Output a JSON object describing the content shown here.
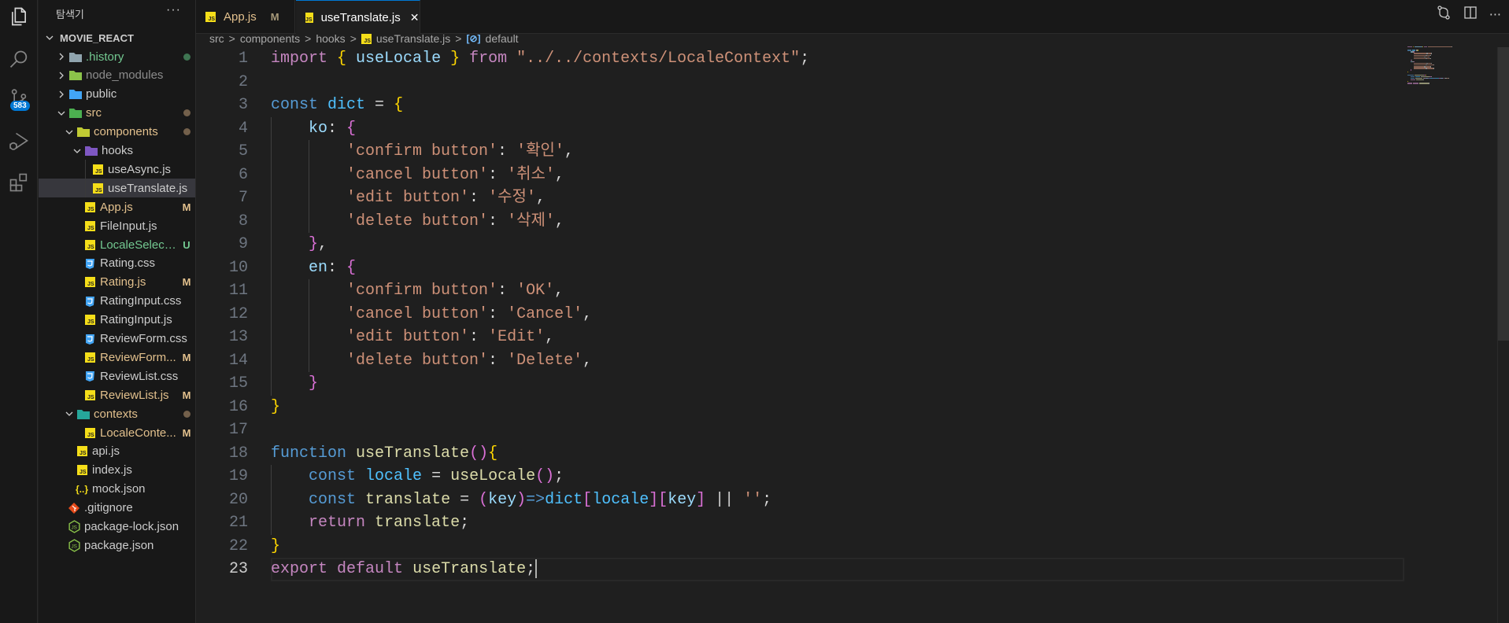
{
  "activity_bar": {
    "items": [
      {
        "name": "explorer",
        "icon": "files-icon"
      },
      {
        "name": "search",
        "icon": "search-icon"
      },
      {
        "name": "source-control",
        "icon": "source-control-icon",
        "badge": "583"
      },
      {
        "name": "run-debug",
        "icon": "run-debug-icon"
      },
      {
        "name": "extensions",
        "icon": "extensions-icon"
      }
    ]
  },
  "sidebar": {
    "title": "탐색기",
    "more": "···",
    "root": "MOVIE_REACT",
    "items": [
      {
        "label": ".history",
        "type": "folder",
        "level": 0,
        "expanded": false,
        "color": "#73c991",
        "icon_color": "#90a4ae",
        "status": "dot",
        "status_color": "#3f7552"
      },
      {
        "label": "node_modules",
        "type": "folder",
        "level": 0,
        "expanded": false,
        "color": "#8c8c8c",
        "icon_color": "#8bc34a",
        "status": ""
      },
      {
        "label": "public",
        "type": "folder",
        "level": 0,
        "expanded": false,
        "color": "#cccccc",
        "icon_color": "#42a5f5",
        "status": ""
      },
      {
        "label": "src",
        "type": "folder",
        "level": 0,
        "expanded": true,
        "color": "#e2c08d",
        "icon_color": "#4caf50",
        "status": "dot",
        "status_color": "#73604b"
      },
      {
        "label": "components",
        "type": "folder",
        "level": 1,
        "expanded": true,
        "color": "#e2c08d",
        "icon_color": "#c0ca33",
        "status": "dot",
        "status_color": "#73604b"
      },
      {
        "label": "hooks",
        "type": "folder",
        "level": 2,
        "expanded": true,
        "color": "#cccccc",
        "icon_color": "#7e57c2",
        "status": ""
      },
      {
        "label": "useAsync.js",
        "type": "js",
        "level": 3,
        "color": "#cccccc",
        "status": ""
      },
      {
        "label": "useTranslate.js",
        "type": "js",
        "level": 3,
        "color": "#cccccc",
        "status": "",
        "selected": true
      },
      {
        "label": "App.js",
        "type": "js",
        "level": 2,
        "color": "#e2c08d",
        "status": "M",
        "status_color": "#e2c08d"
      },
      {
        "label": "FileInput.js",
        "type": "js",
        "level": 2,
        "color": "#cccccc",
        "status": ""
      },
      {
        "label": "LocaleSelect.js",
        "type": "js",
        "level": 2,
        "color": "#73c991",
        "status": "U",
        "status_color": "#73c991"
      },
      {
        "label": "Rating.css",
        "type": "css",
        "level": 2,
        "color": "#cccccc",
        "status": ""
      },
      {
        "label": "Rating.js",
        "type": "js",
        "level": 2,
        "color": "#e2c08d",
        "status": "M",
        "status_color": "#e2c08d"
      },
      {
        "label": "RatingInput.css",
        "type": "css",
        "level": 2,
        "color": "#cccccc",
        "status": ""
      },
      {
        "label": "RatingInput.js",
        "type": "js",
        "level": 2,
        "color": "#cccccc",
        "status": ""
      },
      {
        "label": "ReviewForm.css",
        "type": "css",
        "level": 2,
        "color": "#cccccc",
        "status": ""
      },
      {
        "label": "ReviewForm...",
        "type": "js",
        "level": 2,
        "color": "#e2c08d",
        "status": "M",
        "status_color": "#e2c08d"
      },
      {
        "label": "ReviewList.css",
        "type": "css",
        "level": 2,
        "color": "#cccccc",
        "status": ""
      },
      {
        "label": "ReviewList.js",
        "type": "js",
        "level": 2,
        "color": "#e2c08d",
        "status": "M",
        "status_color": "#e2c08d"
      },
      {
        "label": "contexts",
        "type": "folder",
        "level": 1,
        "expanded": true,
        "color": "#e2c08d",
        "icon_color": "#26a69a",
        "status": "dot",
        "status_color": "#73604b"
      },
      {
        "label": "LocaleConte...",
        "type": "js",
        "level": 2,
        "color": "#e2c08d",
        "status": "M",
        "status_color": "#e2c08d"
      },
      {
        "label": "api.js",
        "type": "js",
        "level": 1,
        "color": "#cccccc",
        "status": ""
      },
      {
        "label": "index.js",
        "type": "js",
        "level": 1,
        "color": "#cccccc",
        "status": ""
      },
      {
        "label": "mock.json",
        "type": "json",
        "level": 1,
        "color": "#cccccc",
        "status": ""
      },
      {
        "label": ".gitignore",
        "type": "git",
        "level": 0,
        "color": "#cccccc",
        "status": ""
      },
      {
        "label": "package-lock.json",
        "type": "node",
        "level": 0,
        "color": "#cccccc",
        "status": ""
      },
      {
        "label": "package.json",
        "type": "node",
        "level": 0,
        "color": "#cccccc",
        "status": ""
      }
    ]
  },
  "tabs": [
    {
      "label": "App.js",
      "status": "M",
      "active": false,
      "color": "#e2c08d"
    },
    {
      "label": "useTranslate.js",
      "close": "✕",
      "active": true,
      "color": "#ffffff"
    }
  ],
  "breadcrumb": {
    "parts": [
      "src",
      "components",
      "hooks"
    ],
    "file": "useTranslate.js",
    "symbol": "default",
    "separator": ">"
  },
  "editor": {
    "current_line": 23,
    "lines": [
      [
        [
          "import",
          "kw"
        ],
        [
          " ",
          "p"
        ],
        [
          "{",
          "b1"
        ],
        [
          " useLocale ",
          "var"
        ],
        [
          "}",
          "b1"
        ],
        [
          " ",
          "p"
        ],
        [
          "from",
          "kw"
        ],
        [
          " \"../../contexts/LocaleContext\"",
          "str"
        ],
        [
          ";",
          "p"
        ]
      ],
      [],
      [
        [
          "const",
          "st"
        ],
        [
          " ",
          "p"
        ],
        [
          "dict",
          "cst"
        ],
        [
          " = ",
          "p"
        ],
        [
          "{",
          "b1"
        ]
      ],
      [
        [
          "    ko",
          "var"
        ],
        [
          ": ",
          "p"
        ],
        [
          "{",
          "b2"
        ]
      ],
      [
        [
          "        'confirm button'",
          "str"
        ],
        [
          ": ",
          "p"
        ],
        [
          "'확인'",
          "str"
        ],
        [
          ",",
          "p"
        ]
      ],
      [
        [
          "        'cancel button'",
          "str"
        ],
        [
          ": ",
          "p"
        ],
        [
          "'취소'",
          "str"
        ],
        [
          ",",
          "p"
        ]
      ],
      [
        [
          "        'edit button'",
          "str"
        ],
        [
          ": ",
          "p"
        ],
        [
          "'수정'",
          "str"
        ],
        [
          ",",
          "p"
        ]
      ],
      [
        [
          "        'delete button'",
          "str"
        ],
        [
          ": ",
          "p"
        ],
        [
          "'삭제'",
          "str"
        ],
        [
          ",",
          "p"
        ]
      ],
      [
        [
          "    ",
          "p"
        ],
        [
          "}",
          "b2"
        ],
        [
          ",",
          "p"
        ]
      ],
      [
        [
          "    en",
          "var"
        ],
        [
          ": ",
          "p"
        ],
        [
          "{",
          "b2"
        ]
      ],
      [
        [
          "        'confirm button'",
          "str"
        ],
        [
          ": ",
          "p"
        ],
        [
          "'OK'",
          "str"
        ],
        [
          ",",
          "p"
        ]
      ],
      [
        [
          "        'cancel button'",
          "str"
        ],
        [
          ": ",
          "p"
        ],
        [
          "'Cancel'",
          "str"
        ],
        [
          ",",
          "p"
        ]
      ],
      [
        [
          "        'edit button'",
          "str"
        ],
        [
          ": ",
          "p"
        ],
        [
          "'Edit'",
          "str"
        ],
        [
          ",",
          "p"
        ]
      ],
      [
        [
          "        'delete button'",
          "str"
        ],
        [
          ": ",
          "p"
        ],
        [
          "'Delete'",
          "str"
        ],
        [
          ",",
          "p"
        ]
      ],
      [
        [
          "    ",
          "p"
        ],
        [
          "}",
          "b2"
        ]
      ],
      [
        [
          "}",
          "b1"
        ]
      ],
      [],
      [
        [
          "function",
          "st"
        ],
        [
          " ",
          "p"
        ],
        [
          "useTranslate",
          "fn"
        ],
        [
          "()",
          "b2"
        ],
        [
          "{",
          "b1"
        ]
      ],
      [
        [
          "    ",
          "p"
        ],
        [
          "const",
          "st"
        ],
        [
          " ",
          "p"
        ],
        [
          "locale",
          "cst"
        ],
        [
          " = ",
          "p"
        ],
        [
          "useLocale",
          "fn"
        ],
        [
          "()",
          "b2"
        ],
        [
          ";",
          "p"
        ]
      ],
      [
        [
          "    ",
          "p"
        ],
        [
          "const",
          "st"
        ],
        [
          " ",
          "p"
        ],
        [
          "translate",
          "fn"
        ],
        [
          " = ",
          "p"
        ],
        [
          "(",
          "b2"
        ],
        [
          "key",
          "var"
        ],
        [
          ")",
          "b2"
        ],
        [
          "=>",
          "st"
        ],
        [
          "dict",
          "cst"
        ],
        [
          "[",
          "b2"
        ],
        [
          "locale",
          "cst"
        ],
        [
          "]",
          "b2"
        ],
        [
          "[",
          "b2"
        ],
        [
          "key",
          "var"
        ],
        [
          "]",
          "b2"
        ],
        [
          " || ",
          "p"
        ],
        [
          "''",
          "str"
        ],
        [
          ";",
          "p"
        ]
      ],
      [
        [
          "    ",
          "p"
        ],
        [
          "return",
          "kw"
        ],
        [
          " ",
          "p"
        ],
        [
          "translate",
          "fn"
        ],
        [
          ";",
          "p"
        ]
      ],
      [
        [
          "}",
          "b1"
        ]
      ],
      [
        [
          "export",
          "kw"
        ],
        [
          " ",
          "p"
        ],
        [
          "default",
          "kw"
        ],
        [
          " ",
          "p"
        ],
        [
          "useTranslate",
          "fn"
        ],
        [
          ";",
          "p"
        ]
      ]
    ]
  },
  "scrollbar": {
    "visible_fraction": 0.51
  }
}
